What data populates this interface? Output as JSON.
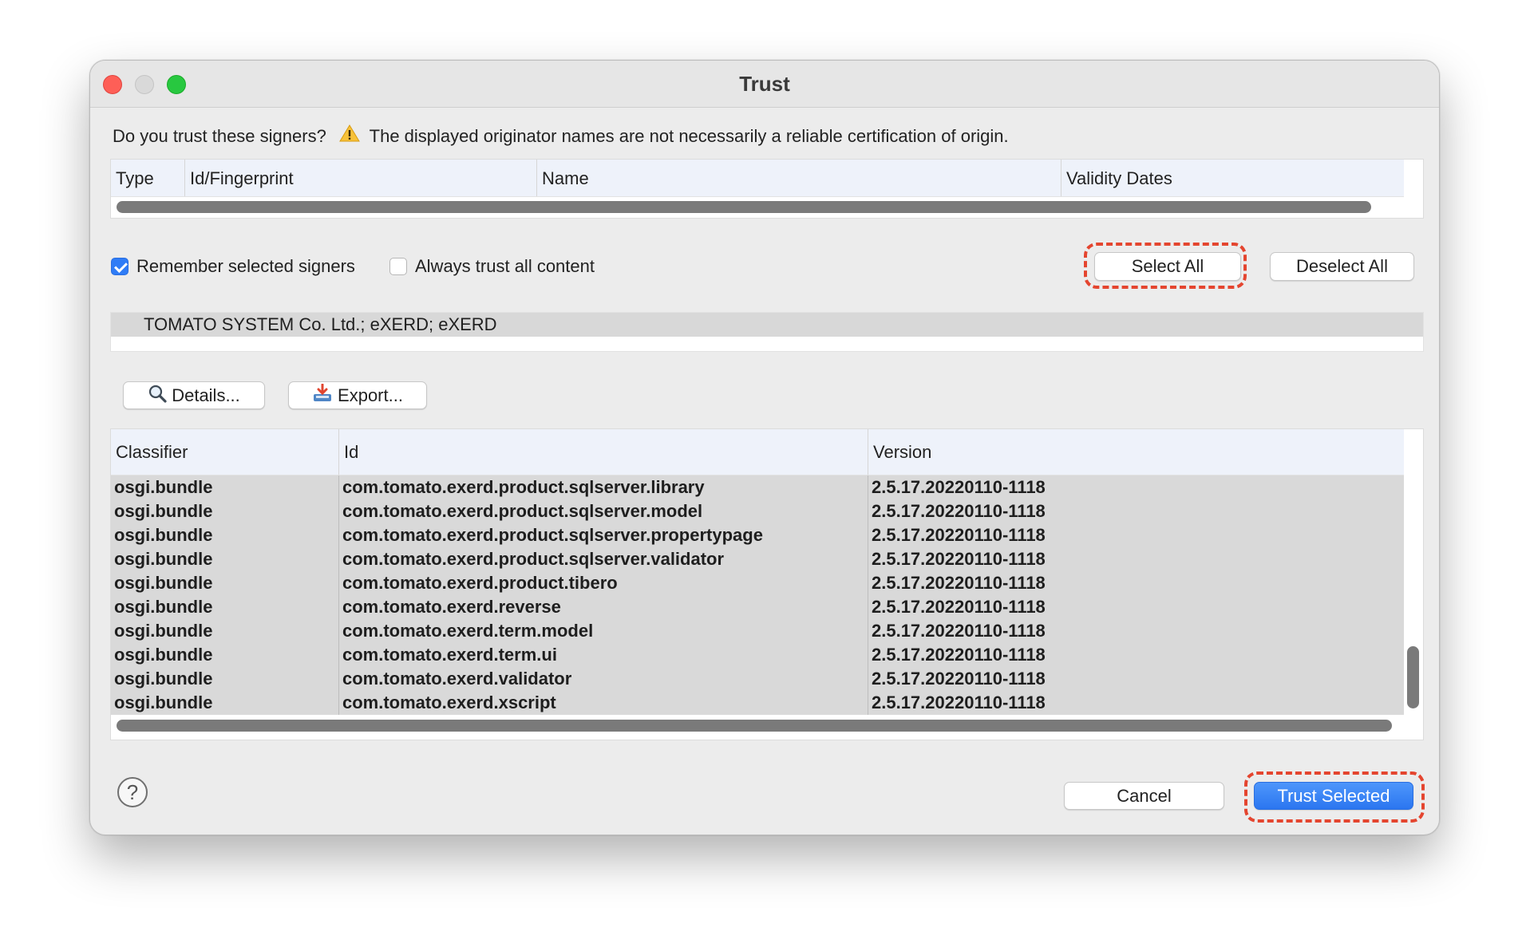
{
  "window": {
    "title": "Trust"
  },
  "message": {
    "question": "Do you trust these signers?",
    "warning": "The displayed originator names are not necessarily a reliable certification of origin.",
    "warning_icon": "warning-icon"
  },
  "signers_table": {
    "columns": [
      "Type",
      "Id/Fingerprint",
      "Name",
      "Validity Dates"
    ]
  },
  "options": {
    "remember_label": "Remember selected signers",
    "remember_checked": true,
    "always_trust_label": "Always trust all content",
    "always_trust_checked": false
  },
  "selection_buttons": {
    "select_all": "Select All",
    "deselect_all": "Deselect All"
  },
  "signer_list": {
    "items": [
      "TOMATO SYSTEM Co. Ltd.; eXERD; eXERD"
    ]
  },
  "action_buttons": {
    "details": "Details...",
    "details_icon": "magnifier-icon",
    "export": "Export...",
    "export_icon": "export-icon"
  },
  "content_table": {
    "columns": [
      "Classifier",
      "Id",
      "Version"
    ],
    "rows": [
      [
        "osgi.bundle",
        "com.tomato.exerd.product.sqlserver.library",
        "2.5.17.20220110-1118"
      ],
      [
        "osgi.bundle",
        "com.tomato.exerd.product.sqlserver.model",
        "2.5.17.20220110-1118"
      ],
      [
        "osgi.bundle",
        "com.tomato.exerd.product.sqlserver.propertypage",
        "2.5.17.20220110-1118"
      ],
      [
        "osgi.bundle",
        "com.tomato.exerd.product.sqlserver.validator",
        "2.5.17.20220110-1118"
      ],
      [
        "osgi.bundle",
        "com.tomato.exerd.product.tibero",
        "2.5.17.20220110-1118"
      ],
      [
        "osgi.bundle",
        "com.tomato.exerd.reverse",
        "2.5.17.20220110-1118"
      ],
      [
        "osgi.bundle",
        "com.tomato.exerd.term.model",
        "2.5.17.20220110-1118"
      ],
      [
        "osgi.bundle",
        "com.tomato.exerd.term.ui",
        "2.5.17.20220110-1118"
      ],
      [
        "osgi.bundle",
        "com.tomato.exerd.validator",
        "2.5.17.20220110-1118"
      ],
      [
        "osgi.bundle",
        "com.tomato.exerd.xscript",
        "2.5.17.20220110-1118"
      ]
    ]
  },
  "footer": {
    "help_icon": "help-icon",
    "help_glyph": "?",
    "cancel": "Cancel",
    "trust_selected": "Trust Selected"
  },
  "colors": {
    "accent": "#2f7cf6",
    "highlight": "#e4452f",
    "close": "#fe5f57",
    "zoom": "#28c840"
  }
}
